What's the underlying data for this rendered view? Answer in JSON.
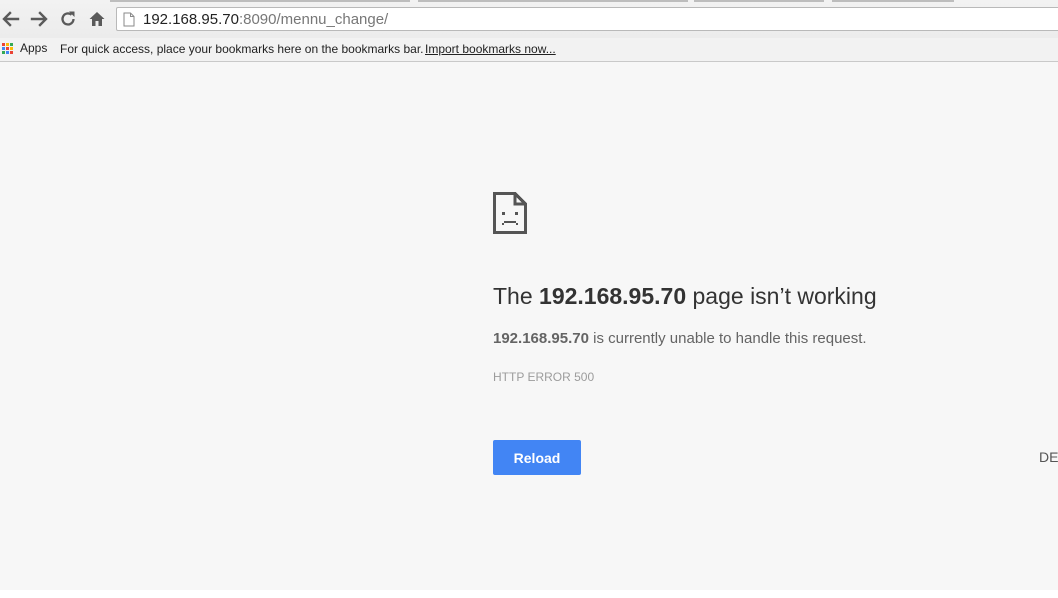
{
  "browser": {
    "url_host": "192.168.95.70",
    "url_path": ":8090/mennu_change/",
    "icons": {
      "back": "back-arrow-icon",
      "forward": "forward-arrow-icon",
      "reload": "reload-icon",
      "home": "home-icon",
      "page": "page-icon"
    }
  },
  "bookmarks_bar": {
    "apps_label": "Apps",
    "message": "For quick access, place your bookmarks here on the bookmarks bar.",
    "import_link": "Import bookmarks now...",
    "apps_colors": [
      "#ea4335",
      "#fbbc05",
      "#34a853",
      "#4285f4",
      "#ea4335",
      "#fbbc05",
      "#34a853",
      "#4285f4",
      "#ea4335"
    ]
  },
  "error_page": {
    "heading_prefix": "The ",
    "heading_host": "192.168.95.70",
    "heading_suffix": " page isn’t working",
    "message_host": "192.168.95.70",
    "message_suffix": " is currently unable to handle this request.",
    "error_code": "HTTP ERROR 500",
    "reload_label": "Reload",
    "details_label": "DETAILS",
    "icon": "sad-page-icon"
  },
  "colors": {
    "accent": "#4285f4",
    "background": "#f7f7f7"
  }
}
